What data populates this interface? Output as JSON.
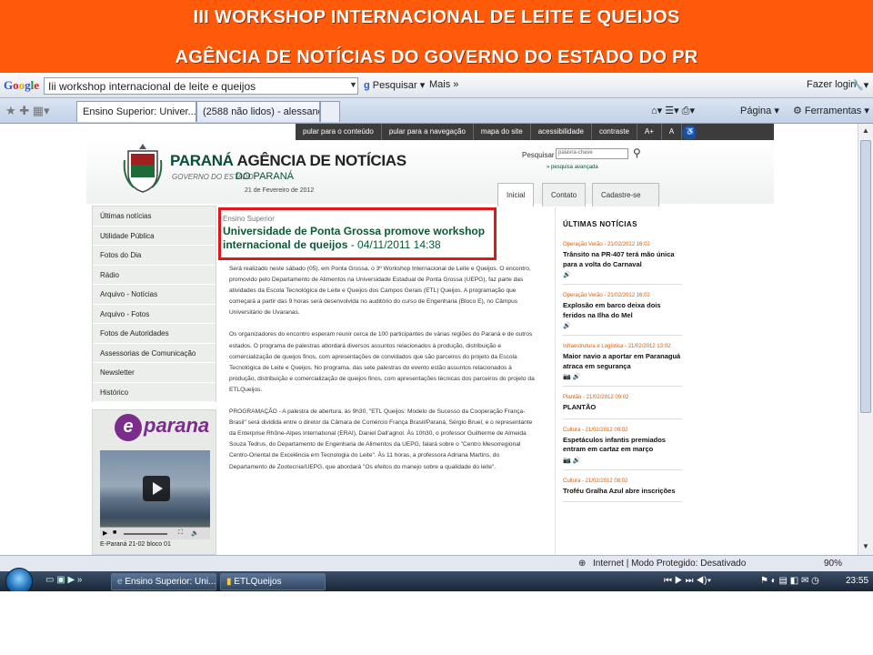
{
  "banner": {
    "line1": "III WORKSHOP INTERNACIONAL DE LEITE E QUEIJOS",
    "line2": "AGÊNCIA DE NOTÍCIAS DO GOVERNO DO ESTADO DO PR"
  },
  "google_toolbar": {
    "logo": "Google",
    "search_value": "Iii workshop internacional de leite e queijos",
    "search_button": "Pesquisar",
    "more": "Mais",
    "login": "Fazer login"
  },
  "tabs": [
    {
      "label": "Ensino Superior: Univer...",
      "active": true
    },
    {
      "label": "(2588 não lidos) - alessand...",
      "active": false
    }
  ],
  "command_bar": {
    "page": "Página",
    "tools": "Ferramentas"
  },
  "site": {
    "topnav": [
      "pular para o conteúdo",
      "pular para a navegação",
      "mapa do site",
      "acessibilidade",
      "contraste",
      "A+",
      "A"
    ],
    "brand_main": "PARANÁ",
    "brand_rest": "AGÊNCIA DE NOTÍCIAS",
    "brand_sub": "GOVERNO DO ESTADO",
    "brand_sub2": "DO PARANÁ",
    "date": "21 de Fevereiro de 2012",
    "search_label": "Pesquisar",
    "search_placeholder": "palavra-chave",
    "advanced_search": "» pesquisa avançada",
    "main_tabs": [
      "Inicial",
      "Contato",
      "Cadastre-se"
    ],
    "sidenav": [
      "Últimas notícias",
      "Utilidade Pública",
      "Fotos do Dia",
      "Rádio",
      "Arquivo - Notícias",
      "Arquivo - Fotos",
      "Fotos de Autoridades",
      "Assessorias de Comunicação",
      "Newsletter",
      "Histórico"
    ],
    "eparana_logo": "parana",
    "video_caption": "E-Paraná 21-02 bloco 01"
  },
  "article": {
    "kicker": "Ensino Superior",
    "headline": "Universidade de Ponta Grossa promove workshop internacional de queijos",
    "date": "- 04/11/2011 14:38",
    "paragraphs": [
      "Será realizado neste sábado (05), em Ponta Grossa, o 3º Workshop Internacional de Leite e Queijos. O encontro, promovido pelo Departamento de Alimentos na Universidade Estadual de Ponta Grossa (UEPG), faz parte das atividades da Escola Tecnológica de Leite e Queijos dos Campos Gerais (ETL) Queijos. A programação que começará a partir das 9 horas será desenvolvida no auditório do curso de Engenharia (Bloco E), no Câmpus Universitário de Uvaranas.",
      "Os organizadores do encontro esperam reunir cerca de 100 participantes de várias regiões do Paraná e de outros estados. O programa de palestras abordará diversos assuntos relacionados à produção, distribuição e comercialização de queijos finos, com apresentações de convidados que são parceiros do projeto da Escola Tecnológica de Leite e Queijos. No programa, das sete palestras do evento estão assuntos relacionados à produção, distribuição e comercialização de queijos finos, com apresentações técnicas dos parceiros do projeto da ETLQueijos.",
      "PROGRAMAÇÃO - A palestra de abertura, às 9h30, \"ETL Queijos: Modelo de Sucesso da Cooperação França-Brasil\" será dividida entre o diretor da Câmara de Comércio França Brasil/Paraná, Sérgio Bruel, e o representante da Enterprise Rhône-Alpes International (ERAI), Daniel Dall'agnol. Às 10h30, o professor Guilherme de Almeida Souza Tedrus, do Departamento de Engenharia de Alimentos da UEPG, falará sobre o \"Centro Mesorregional Centro-Oriental de Excelência em Tecnologia do Leite\". Às 11 horas, a professora Adriana Martins, do Departamento de Zootecnia/UEPG, que abordará \"Os efeitos do manejo sobre a qualidade do leite\"."
    ]
  },
  "news": {
    "title": "ÚLTIMAS NOTÍCIAS",
    "items": [
      {
        "meta": "Operação Verão - 21/02/2012 16:02",
        "headline": "Trânsito na PR-407 terá mão única para a volta do Carnaval"
      },
      {
        "meta": "Operação Verão - 21/02/2012 16:02",
        "headline": "Explosão em barco deixa dois feridos na Ilha do Mel"
      },
      {
        "meta": "Infraestrutura e Logística - 21/02/2012 13:02",
        "headline": "Maior navio a aportar em Paranaguá atraca em segurança"
      },
      {
        "meta": "Plantão - 21/02/2012 09:02",
        "headline": "PLANTÃO"
      },
      {
        "meta": "Cultura - 21/02/2012 09:02",
        "headline": "Espetáculos infantis premiados entram em cartaz em março"
      },
      {
        "meta": "Cultura - 21/02/2012 08:02",
        "headline": "Troféu Gralha Azul abre inscrições"
      }
    ]
  },
  "statusbar": {
    "zone": "Internet | Modo Protegido: Desativado",
    "zoom": "90%"
  },
  "taskbar": {
    "items": [
      "Ensino Superior: Uni...",
      "ETLQueijos"
    ],
    "time": "23:55"
  }
}
